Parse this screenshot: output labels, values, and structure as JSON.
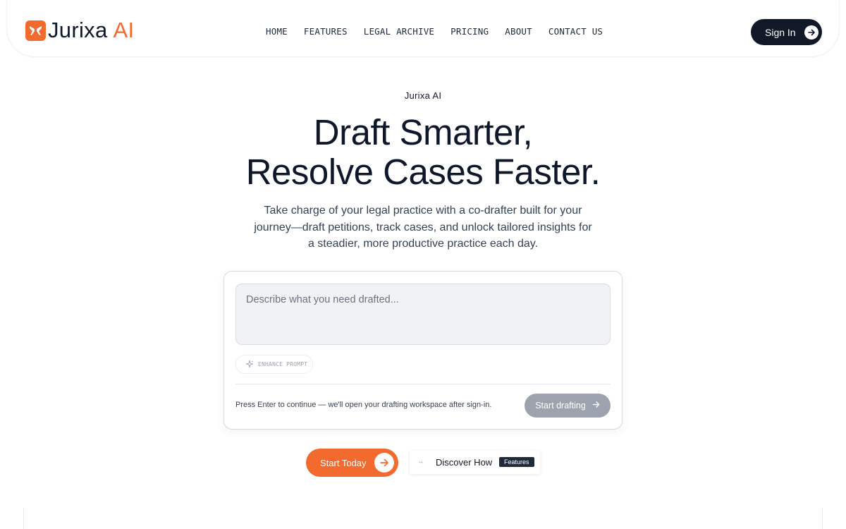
{
  "brand": {
    "name": "Jurixa",
    "suffix": "AI",
    "accent": "#f26a2e"
  },
  "nav": {
    "items": [
      {
        "label": "HOME"
      },
      {
        "label": "FEATURES"
      },
      {
        "label": "LEGAL ARCHIVE"
      },
      {
        "label": "PRICING"
      },
      {
        "label": "ABOUT"
      },
      {
        "label": "CONTACT US"
      }
    ],
    "signin_label": "Sign In",
    "signin_icon": "arrow-right-icon"
  },
  "hero": {
    "eyebrow": "Jurixa AI",
    "headline_line1": "Draft Smarter,",
    "headline_line2": "Resolve Cases Faster.",
    "subtext": "Take charge of your legal practice with a co-drafter built for your journey—draft petitions, track cases, and unlock tailored insights for a steadier, more productive practice each day."
  },
  "composer": {
    "placeholder": "Describe what you need drafted...",
    "value": "",
    "enhance_label": "ENHANCE PROMPT",
    "enhance_icon": "sparkles-icon",
    "hint": "Press Enter to continue — we'll open your drafting workspace after sign-in.",
    "submit_label": "Start drafting",
    "submit_icon": "arrow-right-icon"
  },
  "cta": {
    "primary_label": "Start Today",
    "primary_icon": "arrow-right-icon",
    "secondary_label": "Discover How",
    "secondary_badge": "Features",
    "secondary_icon": "arrow-right-icon"
  },
  "colors": {
    "dark": "#111827",
    "muted_button": "#9ca3af"
  }
}
